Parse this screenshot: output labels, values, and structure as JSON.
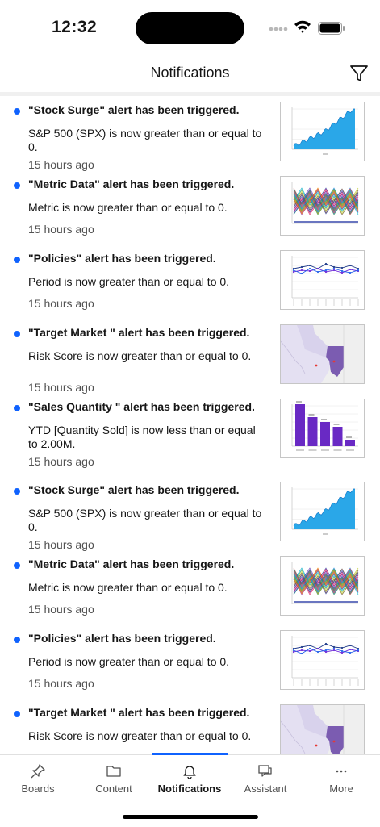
{
  "status_bar": {
    "time": "12:32"
  },
  "header": {
    "title": "Notifications"
  },
  "notifications": [
    {
      "title": "\"Stock Surge\" alert has been triggered.",
      "message": "S&P 500 (SPX) is now greater than or equal to 0.",
      "time": "15 hours ago",
      "thumbnail": "area-chart"
    },
    {
      "title": "\"Metric Data\" alert has been triggered.",
      "message": "Metric is now greater than or equal to 0.",
      "time": "15 hours ago",
      "thumbnail": "multi-line-chart"
    },
    {
      "title": "\"Policies\" alert has been triggered.",
      "message": "Period is now greater than or equal to 0.",
      "time": "15 hours ago",
      "thumbnail": "line-chart"
    },
    {
      "title": "\"Target Market \" alert has been triggered.",
      "message": "Risk Score is now greater than or equal to 0.",
      "time": "15 hours ago",
      "thumbnail": "map"
    },
    {
      "title": "\"Sales Quantity \" alert has been triggered.",
      "message": "YTD [Quantity Sold] is now less than or equal to 2.00M.",
      "time": "15 hours ago",
      "thumbnail": "bar-chart"
    },
    {
      "title": "\"Stock Surge\" alert has been triggered.",
      "message": "S&P 500 (SPX) is now greater than or equal to 0.",
      "time": "15 hours ago",
      "thumbnail": "area-chart"
    },
    {
      "title": "\"Metric Data\" alert has been triggered.",
      "message": "Metric is now greater than or equal to 0.",
      "time": "15 hours ago",
      "thumbnail": "multi-line-chart"
    },
    {
      "title": "\"Policies\" alert has been triggered.",
      "message": "Period is now greater than or equal to 0.",
      "time": "15 hours ago",
      "thumbnail": "line-chart"
    },
    {
      "title": "\"Target Market \" alert has been triggered.",
      "message": "Risk Score is now greater than or equal to 0.",
      "time": "",
      "thumbnail": "map"
    }
  ],
  "tabbar": {
    "active_index": 2,
    "accent": "#0f62fe",
    "tabs": [
      {
        "label": "Boards",
        "icon": "pin-icon"
      },
      {
        "label": "Content",
        "icon": "folder-icon"
      },
      {
        "label": "Notifications",
        "icon": "bell-icon"
      },
      {
        "label": "Assistant",
        "icon": "chat-icon"
      },
      {
        "label": "More",
        "icon": "more-icon"
      }
    ]
  }
}
